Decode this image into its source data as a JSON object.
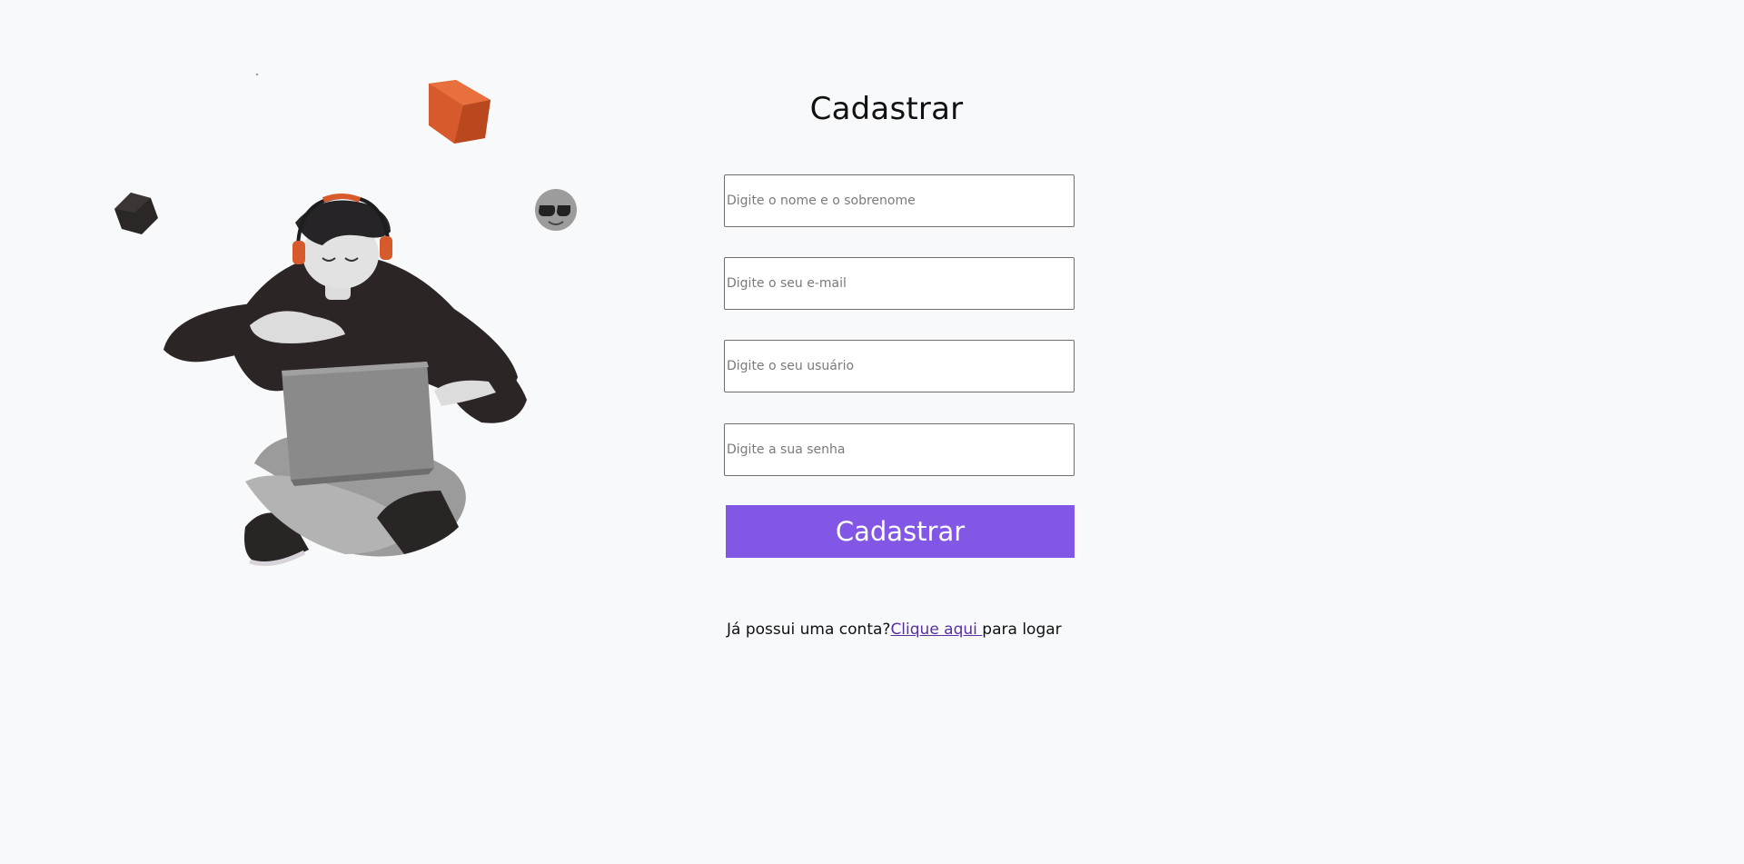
{
  "form": {
    "title": "Cadastrar",
    "fields": {
      "name_placeholder": "Digite o nome e o sobrenome",
      "email_placeholder": "Digite o seu e-mail",
      "username_placeholder": "Digite o seu usuário",
      "password_placeholder": "Digite a sua senha"
    },
    "submit_label": "Cadastrar"
  },
  "login_prompt": {
    "prefix": "Já possui uma conta?",
    "link_label": "Clique aqui ",
    "suffix": "para logar"
  },
  "colors": {
    "background": "#f8f9fa",
    "accent": "#8257e5",
    "link": "#5a2fa0"
  },
  "illustration": {
    "icons": [
      "person-with-laptop-icon",
      "orange-cube-icon",
      "dark-cube-icon",
      "sunglasses-emoji-icon"
    ]
  }
}
